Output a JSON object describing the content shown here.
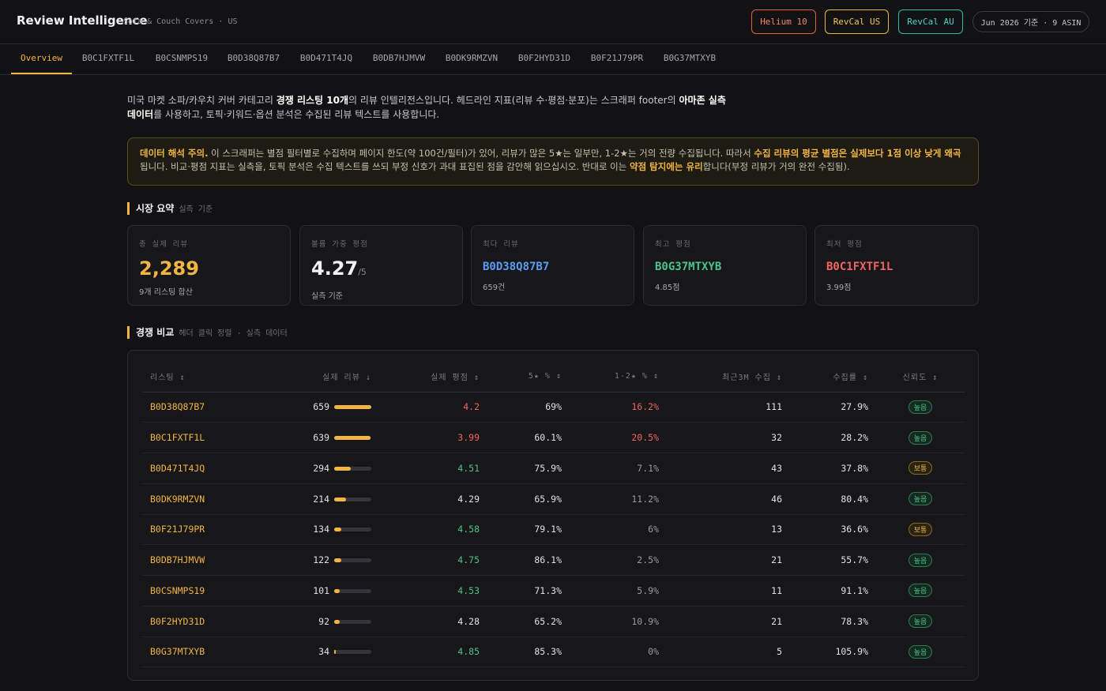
{
  "header": {
    "title": "Review Intelligence",
    "subtitle": "Sofa & Couch Covers · US",
    "buttons": {
      "helium": "Helium 10",
      "revcal_us": "RevCal US",
      "revcal_au": "RevCal AU"
    },
    "badge": "Jun 2026 기준 · 9 ASIN"
  },
  "tabs": [
    "Overview",
    "B0C1FXTF1L",
    "B0CSNMPS19",
    "B0D38Q87B7",
    "B0D471T4JQ",
    "B0DB7HJMVW",
    "B0DK9RMZVN",
    "B0F2HYD31D",
    "B0F21J79PR",
    "B0G37MTXYB"
  ],
  "intro": {
    "p1": "미국 마켓 소파/카우치 커버 카테고리 ",
    "b1": "경쟁 리스팅 10개",
    "p2": "의 리뷰 인텔리전스입니다. 헤드라인 지표(리뷰 수·평점·분포)는 스크래퍼 footer의 ",
    "b2": "아마존 실측 데이터",
    "p3": "를 사용하고, 토픽·키워드·옵션 분석은 수집된 리뷰 텍스트를 사용합니다."
  },
  "notice": {
    "h1": "데이터 해석 주의.",
    "t1": " 이 스크래퍼는 별점 필터별로 수집하며 페이지 한도(약 100건/필터)가 있어, 리뷰가 많은 5★는 일부만, 1-2★는 거의 전량 수집됩니다. 따라서 ",
    "h2": "수집 리뷰의 평균 별점은 실제보다 1점 이상 낮게 왜곡",
    "t2": "됩니다. 비교·평점 지표는 실측을, 토픽 분석은 수집 텍스트를 쓰되 부정 신호가 과대 표집된 점을 감안해 읽으십시오. 반대로 이는 ",
    "h3": "약점 탐지에는 유리",
    "t3": "합니다(부정 리뷰가 거의 완전 수집됨)."
  },
  "market_summary": {
    "title": "시장 요약",
    "sub": "실측 기준",
    "cards": [
      {
        "label": "총 실제 리뷰",
        "value": "2,289",
        "note": "9개 리스팅 합산"
      },
      {
        "label": "볼륨 가중 평점",
        "value": "4.27",
        "unit": "/5",
        "note": "실측 기준"
      },
      {
        "label": "최다 리뷰",
        "value": "B0D38Q87B7",
        "note": "659건"
      },
      {
        "label": "최고 평점",
        "value": "B0G37MTXYB",
        "note": "4.85점"
      },
      {
        "label": "최저 평점",
        "value": "B0C1FXTF1L",
        "note": "3.99점"
      }
    ]
  },
  "comparison": {
    "title": "경쟁 비교",
    "sub": "헤더 클릭 정렬 · 실측 데이터",
    "headers": [
      "리스팅 ↕",
      "실제 리뷰 ↓",
      "실제 평점 ↕",
      "5★ % ↕",
      "1-2★ % ↕",
      "최근3M 수집 ↕",
      "수집률 ↕",
      "신뢰도 ↕"
    ],
    "rows": [
      {
        "asin": "B0D38Q87B7",
        "reviews": "659",
        "share": 1.0,
        "rating": "4.2",
        "rating_tone": "red",
        "five": "69%",
        "low": "16.2%",
        "low_tone": "red",
        "recent": "111",
        "rate": "27.9%",
        "trust": "높음",
        "trust_tone": "high"
      },
      {
        "asin": "B0C1FXTF1L",
        "reviews": "639",
        "share": 0.97,
        "rating": "3.99",
        "rating_tone": "red",
        "five": "60.1%",
        "low": "20.5%",
        "low_tone": "red",
        "recent": "32",
        "rate": "28.2%",
        "trust": "높음",
        "trust_tone": "high"
      },
      {
        "asin": "B0D471T4JQ",
        "reviews": "294",
        "share": 0.45,
        "rating": "4.51",
        "rating_tone": "green",
        "five": "75.9%",
        "low": "7.1%",
        "low_tone": "dim",
        "recent": "43",
        "rate": "37.8%",
        "trust": "보통",
        "trust_tone": "mid"
      },
      {
        "asin": "B0DK9RMZVN",
        "reviews": "214",
        "share": 0.32,
        "rating": "4.29",
        "rating_tone": "plain",
        "five": "65.9%",
        "low": "11.2%",
        "low_tone": "dim",
        "recent": "46",
        "rate": "80.4%",
        "trust": "높음",
        "trust_tone": "high"
      },
      {
        "asin": "B0F21J79PR",
        "reviews": "134",
        "share": 0.2,
        "rating": "4.58",
        "rating_tone": "green",
        "five": "79.1%",
        "low": "6%",
        "low_tone": "dim",
        "recent": "13",
        "rate": "36.6%",
        "trust": "보통",
        "trust_tone": "mid"
      },
      {
        "asin": "B0DB7HJMVW",
        "reviews": "122",
        "share": 0.19,
        "rating": "4.75",
        "rating_tone": "green",
        "five": "86.1%",
        "low": "2.5%",
        "low_tone": "dim",
        "recent": "21",
        "rate": "55.7%",
        "trust": "높음",
        "trust_tone": "high"
      },
      {
        "asin": "B0CSNMPS19",
        "reviews": "101",
        "share": 0.15,
        "rating": "4.53",
        "rating_tone": "green",
        "five": "71.3%",
        "low": "5.9%",
        "low_tone": "dim",
        "recent": "11",
        "rate": "91.1%",
        "trust": "높음",
        "trust_tone": "high"
      },
      {
        "asin": "B0F2HYD31D",
        "reviews": "92",
        "share": 0.14,
        "rating": "4.28",
        "rating_tone": "plain",
        "five": "65.2%",
        "low": "10.9%",
        "low_tone": "dim",
        "recent": "21",
        "rate": "78.3%",
        "trust": "높음",
        "trust_tone": "high"
      },
      {
        "asin": "B0G37MTXYB",
        "reviews": "34",
        "share": 0.05,
        "rating": "4.85",
        "rating_tone": "green",
        "five": "85.3%",
        "low": "0%",
        "low_tone": "dim",
        "recent": "5",
        "rate": "105.9%",
        "trust": "높음",
        "trust_tone": "high"
      }
    ]
  },
  "colors": {
    "accent": "#f2b544",
    "blue": "#5b9cf5",
    "green": "#4cc38a",
    "red": "#f26464"
  }
}
